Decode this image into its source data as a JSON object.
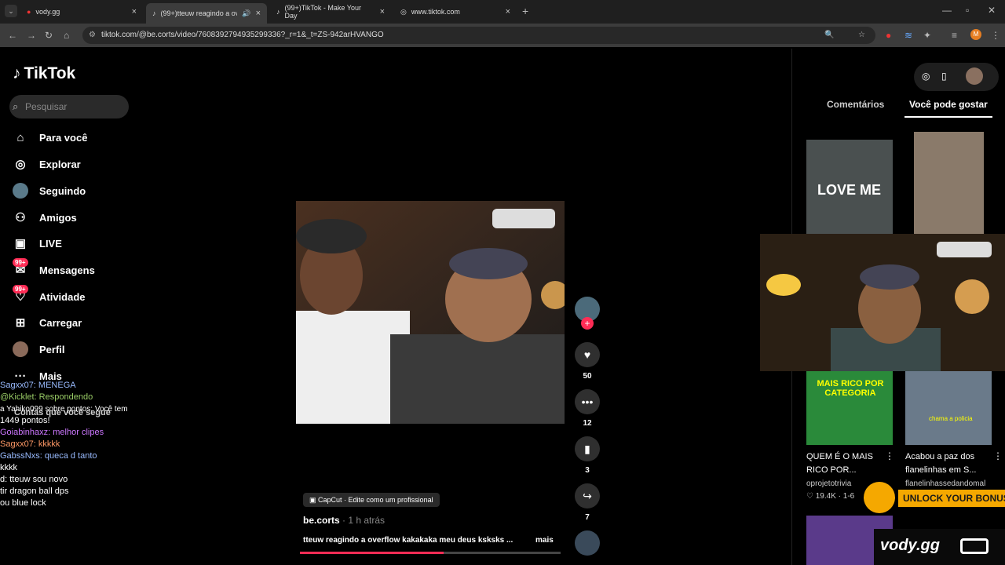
{
  "browser": {
    "tabs": [
      {
        "title": "vody.gg"
      },
      {
        "title": "(99+)tteuw reagindo a over"
      },
      {
        "title": "(99+)TikTok - Make Your Day"
      },
      {
        "title": "www.tiktok.com"
      }
    ],
    "url": "tiktok.com/@be.corts/video/7608392794935299336?_r=1&_t=ZS-942arHVANGO"
  },
  "sidebar": {
    "logo": "TikTok",
    "search_placeholder": "Pesquisar",
    "items": [
      {
        "label": "Para você",
        "icon": "home-icon"
      },
      {
        "label": "Explorar",
        "icon": "compass-icon"
      },
      {
        "label": "Seguindo",
        "icon": "avatar-icon"
      },
      {
        "label": "Amigos",
        "icon": "friends-icon"
      },
      {
        "label": "LIVE",
        "icon": "live-icon"
      },
      {
        "label": "Mensagens",
        "icon": "message-icon",
        "badge": "99+"
      },
      {
        "label": "Atividade",
        "icon": "activity-icon",
        "badge": "99+"
      },
      {
        "label": "Carregar",
        "icon": "upload-icon"
      },
      {
        "label": "Perfil",
        "icon": "profile-icon"
      },
      {
        "label": "Mais",
        "icon": "more-icon"
      }
    ],
    "following_header": "Contas que você segue"
  },
  "chat_overlay": [
    "Sagxx07: MENEGA",
    "@Kicklet: Respondendo",
    "a Yahiko099 sobre pontos: Você tem",
    "1449 pontos!",
    "Goiabinhaxz: melhor clipes",
    "Sagxx07: kkkkk",
    "GabssNxs: queca d tanto",
    "kkkk",
    "d: tteuw sou novo",
    "tir dragon ball dps",
    "ou blue lock"
  ],
  "video": {
    "capcut": "CapCut · Edite como um profissional",
    "author": "be.corts",
    "time": " · 1 h atrás",
    "description": "tteuw reagindo a overflow kakakaka meu deus ksksks ...",
    "more": "mais",
    "progress": 0.55,
    "likes": "50",
    "comments": "12",
    "saves": "3",
    "shares": "7"
  },
  "right_panel": {
    "tab_comments": "Comentários",
    "tab_suggested": "Você pode gostar",
    "thumb1_text": "LOVE ME",
    "items": [
      {
        "title": "QUEM É O MAIS RICO POR...",
        "author": "oprojetotrivia",
        "stats": "19.4K · 1-6",
        "thumb_text": "MAIS RICO POR CATEGORIA"
      },
      {
        "title": "Acabou a paz dos flanelinhas em S...",
        "author": "flanelinhassedandomal",
        "stats": "",
        "thumb_text": "chama a policia"
      }
    ]
  },
  "overlays": {
    "unlock": "UNLOCK YOUR BONUS",
    "vody": "vody.gg"
  }
}
